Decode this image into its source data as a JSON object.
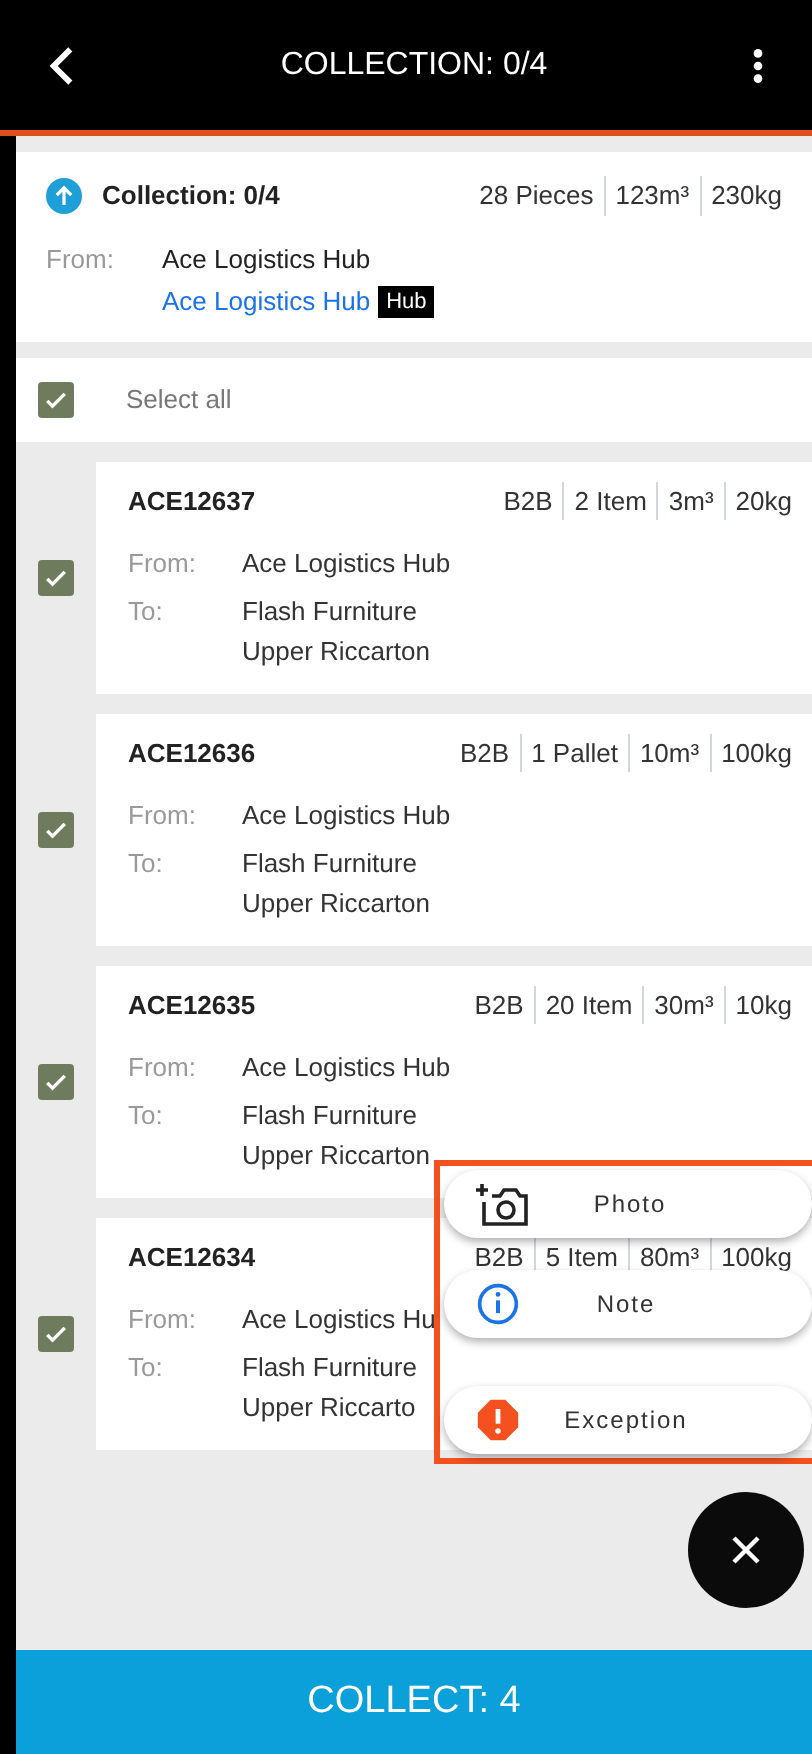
{
  "header": {
    "title": "COLLECTION: 0/4"
  },
  "summary": {
    "title": "Collection: 0/4",
    "stats": [
      "28 Pieces",
      "123m³",
      "230kg"
    ],
    "from_label": "From:",
    "from_name": "Ace Logistics Hub",
    "from_link": "Ace Logistics Hub",
    "badge": "Hub"
  },
  "select_all": {
    "label": "Select all",
    "checked": true
  },
  "consignments": [
    {
      "id": "ACE12637",
      "stats": [
        "B2B",
        "2 Item",
        "3m³",
        "20kg"
      ],
      "checked": true,
      "from_label": "From:",
      "from": "Ace Logistics Hub",
      "to_label": "To:",
      "to": "Flash Furniture",
      "to_area": "Upper Riccarton"
    },
    {
      "id": "ACE12636",
      "stats": [
        "B2B",
        "1 Pallet",
        "10m³",
        "100kg"
      ],
      "checked": true,
      "from_label": "From:",
      "from": "Ace Logistics Hub",
      "to_label": "To:",
      "to": "Flash Furniture",
      "to_area": "Upper Riccarton"
    },
    {
      "id": "ACE12635",
      "stats": [
        "B2B",
        "20 Item",
        "30m³",
        "10kg"
      ],
      "checked": true,
      "from_label": "From:",
      "from": "Ace Logistics Hub",
      "to_label": "To:",
      "to": "Flash Furniture",
      "to_area": "Upper Riccarton"
    },
    {
      "id": "ACE12634",
      "stats": [
        "B2B",
        "5 Item",
        "80m³",
        "100kg"
      ],
      "checked": true,
      "from_label": "From:",
      "from": "Ace Logistics Hu",
      "to_label": "To:",
      "to": "Flash Furniture",
      "to_area": "Upper Riccarto"
    }
  ],
  "actions": [
    {
      "kind": "photo",
      "label": "Photo"
    },
    {
      "kind": "note",
      "label": "Note"
    },
    {
      "kind": "exception",
      "label": "Exception"
    }
  ],
  "collect_button": {
    "label": "COLLECT: 4"
  }
}
